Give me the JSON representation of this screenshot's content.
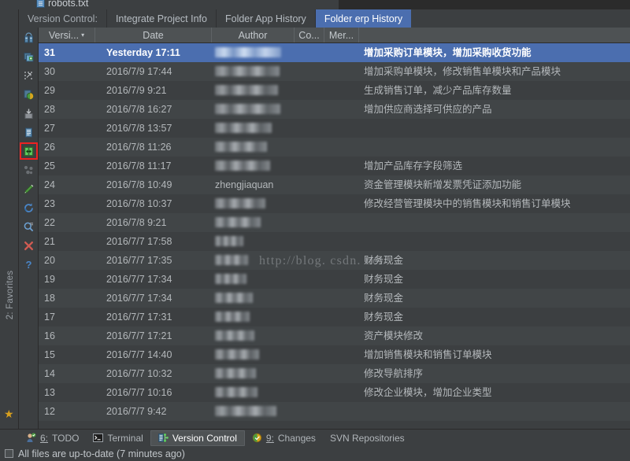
{
  "editor": {
    "open_tab": "robots.txt",
    "tab_icon": "text-file-icon"
  },
  "toolwindow": {
    "title": "Version Control:",
    "tabs": [
      {
        "label": "Integrate Project Info",
        "selected": false
      },
      {
        "label": "Folder App History",
        "selected": false
      },
      {
        "label": "Folder erp History",
        "selected": true
      }
    ]
  },
  "left_toolbar": {
    "buttons": [
      {
        "name": "vcs-browse-repository-icon",
        "highlighted": false
      },
      {
        "name": "add-to-vcs-icon",
        "highlighted": false
      },
      {
        "name": "expand-selection-icon",
        "highlighted": false
      },
      {
        "name": "show-diff-icon",
        "highlighted": false
      },
      {
        "name": "checkout-icon",
        "highlighted": false
      },
      {
        "name": "copy-details-icon",
        "highlighted": false
      },
      {
        "name": "compare-with-local-icon",
        "highlighted": true
      },
      {
        "name": "merge-icon",
        "highlighted": false
      },
      {
        "name": "annotate-icon",
        "highlighted": false
      },
      {
        "name": "refresh-icon",
        "highlighted": false
      },
      {
        "name": "filter-search-icon",
        "highlighted": false
      },
      {
        "name": "close-icon",
        "highlighted": false
      },
      {
        "name": "help-icon",
        "highlighted": false
      }
    ]
  },
  "favorites_strip": {
    "label": "2: Favorites",
    "star_icon": "star-icon"
  },
  "table": {
    "columns": [
      {
        "key": "revision",
        "label": "Versi...",
        "sorted": true,
        "sort_caret": "▾"
      },
      {
        "key": "date",
        "label": "Date",
        "sorted": false
      },
      {
        "key": "author",
        "label": "Author",
        "sorted": false
      },
      {
        "key": "commit",
        "label": "Co...",
        "sorted": false
      },
      {
        "key": "merge",
        "label": "Mer...",
        "sorted": false
      },
      {
        "key": "message",
        "label": "",
        "sorted": false
      }
    ],
    "rows": [
      {
        "revision": "31",
        "date": "Yesterday 17:11",
        "author": "",
        "author_redacted": true,
        "redact_width": 84,
        "message": "增加采购订单模块，增加采购收货功能",
        "selected": true
      },
      {
        "revision": "30",
        "date": "2016/7/9 17:44",
        "author": "",
        "author_redacted": true,
        "redact_width": 82,
        "message": "增加采购单模块，修改销售单模块和产品模块",
        "selected": false
      },
      {
        "revision": "29",
        "date": "2016/7/9 9:21",
        "author": "",
        "author_redacted": true,
        "redact_width": 80,
        "message": "生成销售订单，减少产品库存数量",
        "selected": false
      },
      {
        "revision": "28",
        "date": "2016/7/8 16:27",
        "author": "",
        "author_redacted": true,
        "redact_width": 83,
        "message": "增加供应商选择可供应的产品",
        "selected": false
      },
      {
        "revision": "27",
        "date": "2016/7/8 13:57",
        "author": "",
        "author_redacted": true,
        "redact_width": 72,
        "message": "",
        "selected": false
      },
      {
        "revision": "26",
        "date": "2016/7/8 11:26",
        "author": "",
        "author_redacted": true,
        "redact_width": 66,
        "message": "",
        "selected": false
      },
      {
        "revision": "25",
        "date": "2016/7/8 11:17",
        "author": "",
        "author_redacted": true,
        "redact_width": 70,
        "message": "增加产品库存字段筛选",
        "selected": false
      },
      {
        "revision": "24",
        "date": "2016/7/8 10:49",
        "author": "zhengjiaquan",
        "author_redacted": false,
        "redact_width": 0,
        "message": "资金管理模块新增发票凭证添加功能",
        "selected": false
      },
      {
        "revision": "23",
        "date": "2016/7/8 10:37",
        "author": "",
        "author_redacted": true,
        "redact_width": 64,
        "message": "修改经营管理模块中的销售模块和销售订单模块",
        "selected": false
      },
      {
        "revision": "22",
        "date": "2016/7/8 9:21",
        "author": "",
        "author_redacted": true,
        "redact_width": 58,
        "message": "",
        "selected": false
      },
      {
        "revision": "21",
        "date": "2016/7/7 17:58",
        "author": "",
        "author_redacted": true,
        "redact_width": 36,
        "message": "",
        "selected": false
      },
      {
        "revision": "20",
        "date": "2016/7/7 17:35",
        "author": "",
        "author_redacted": true,
        "redact_width": 42,
        "message": "财务现金",
        "selected": false
      },
      {
        "revision": "19",
        "date": "2016/7/7 17:34",
        "author": "",
        "author_redacted": true,
        "redact_width": 40,
        "message": "财务现金",
        "selected": false
      },
      {
        "revision": "18",
        "date": "2016/7/7 17:34",
        "author": "",
        "author_redacted": true,
        "redact_width": 48,
        "message": "财务现金",
        "selected": false
      },
      {
        "revision": "17",
        "date": "2016/7/7 17:31",
        "author": "",
        "author_redacted": true,
        "redact_width": 44,
        "message": "财务现金",
        "selected": false
      },
      {
        "revision": "16",
        "date": "2016/7/7 17:21",
        "author": "",
        "author_redacted": true,
        "redact_width": 50,
        "message": "资产模块修改",
        "selected": false
      },
      {
        "revision": "15",
        "date": "2016/7/7 14:40",
        "author": "",
        "author_redacted": true,
        "redact_width": 56,
        "message": "增加销售模块和销售订单模块",
        "selected": false
      },
      {
        "revision": "14",
        "date": "2016/7/7 10:32",
        "author": "",
        "author_redacted": true,
        "redact_width": 52,
        "message": "修改导航排序",
        "selected": false
      },
      {
        "revision": "13",
        "date": "2016/7/7 10:16",
        "author": "",
        "author_redacted": true,
        "redact_width": 54,
        "message": "修改企业模块，增加企业类型",
        "selected": false
      },
      {
        "revision": "12",
        "date": "2016/7/7 9:42",
        "author": "",
        "author_redacted": true,
        "redact_width": 78,
        "message": "",
        "selected": false
      }
    ]
  },
  "watermark": "http://blog. csdn. net/",
  "bottom_bar": {
    "items": [
      {
        "label": "TODO",
        "mnemonic": "6:",
        "icon": "todo-icon",
        "active": false
      },
      {
        "label": "Terminal",
        "mnemonic": "",
        "icon": "terminal-icon",
        "active": false
      },
      {
        "label": "Version Control",
        "mnemonic": "",
        "icon": "version-control-icon",
        "active": true
      },
      {
        "label": "Changes",
        "mnemonic": "9:",
        "icon": "changes-icon",
        "active": false
      },
      {
        "label": "SVN Repositories",
        "mnemonic": "",
        "icon": "",
        "active": false
      }
    ]
  },
  "status_bar": {
    "icon": "sync-status-icon",
    "text": "All files are up-to-date (7 minutes ago)"
  },
  "colors": {
    "background": "#3c3f41",
    "row_alt": "#414547",
    "selection": "#4b6eaf",
    "header": "#4e5254",
    "text": "#b4b8bb",
    "highlight_box": "#ee2222"
  }
}
